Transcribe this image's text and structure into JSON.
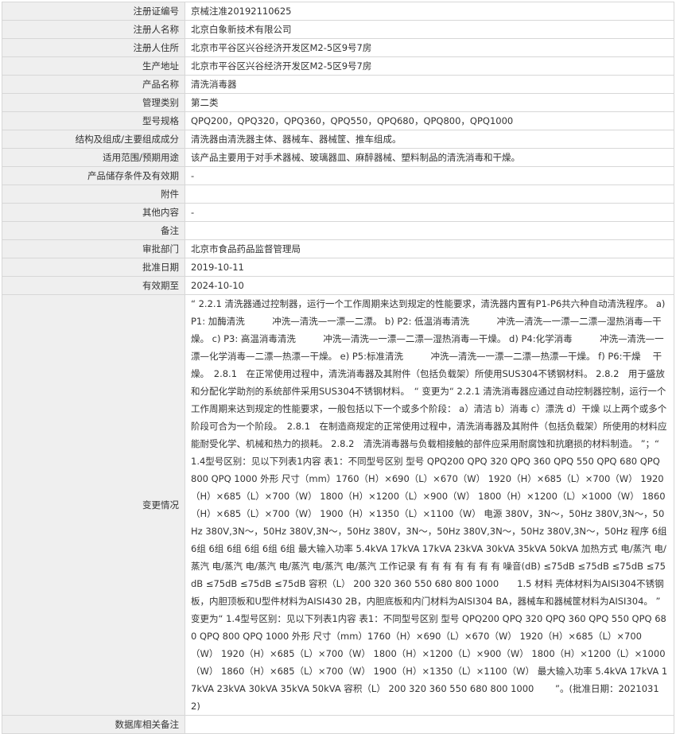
{
  "rows": [
    {
      "label": "注册证编号",
      "value": "京械注准20192110625"
    },
    {
      "label": "注册人名称",
      "value": "北京白象新技术有限公司"
    },
    {
      "label": "注册人住所",
      "value": "北京市平谷区兴谷经济开发区M2-5区9号7房"
    },
    {
      "label": "生产地址",
      "value": "北京市平谷区兴谷经济开发区M2-5区9号7房"
    },
    {
      "label": "产品名称",
      "value": "清洗消毒器"
    },
    {
      "label": "管理类别",
      "value": "第二类"
    },
    {
      "label": "型号规格",
      "value": "QPQ200，QPQ320，QPQ360，QPQ550，QPQ680，QPQ800，QPQ1000"
    },
    {
      "label": "结构及组成/主要组成成分",
      "value": "清洗器由清洗器主体、器械车、器械筐、推车组成。"
    },
    {
      "label": "适用范围/预期用途",
      "value": "该产品主要用于对手术器械、玻璃器皿、麻醉器械、塑料制品的清洗消毒和干燥。"
    },
    {
      "label": "产品储存条件及有效期",
      "value": "-"
    },
    {
      "label": "附件",
      "value": ""
    },
    {
      "label": "其他内容",
      "value": "-"
    },
    {
      "label": "备注",
      "value": ""
    },
    {
      "label": "审批部门",
      "value": "北京市食品药品监督管理局"
    },
    {
      "label": "批准日期",
      "value": "2019-10-11"
    },
    {
      "label": "有效期至",
      "value": "2024-10-10"
    },
    {
      "label": "变更情况",
      "value": "“ 2.2.1 清洗器通过控制器，运行一个工作周期来达到规定的性能要求，清洗器内置有P1-P6共六种自动清洗程序。 a) P1: 加酶清洗　　　冲洗—清洗—一漂—二漂。 b) P2: 低温消毒清洗　　　冲洗—清洗—一漂—二漂—湿热消毒—干燥。 c) P3: 高温消毒清洗　　　冲洗—清洗—一漂—二漂—湿热消毒—干燥。 d) P4:化学消毒　　　冲洗—清洗—一漂—化学消毒—二漂—热漂—干燥。 e) P5:标准清洗　　　冲洗—清洗—一漂—二漂—热漂—干燥。 f) P6:干燥　 干燥。　2.8.1　在正常使用过程中，清洗消毒器及其附件（包括负载架）所使用SUS304不锈钢材料。 2.8.2　用于盛放和分配化学助剂的系统部件采用SUS304不锈钢材料。　“ 变更为“ 2.2.1 清洗消毒器应通过自动控制器控制，运行一个工作周期来达到规定的性能要求，一般包括以下一个或多个阶段： a）清洁 b）消毒 c）漂洗 d）干燥 以上两个或多个阶段可合为一个阶段。　2.8.1　在制造商规定的正常使用过程中，清洗消毒器及其附件（包括负载架）所使用的材料应能耐受化学、机械和热力的损耗。 2.8.2　清洗消毒器与负载相接触的部件应采用耐腐蚀和抗磨损的材料制造。 ”；“ 1.4型号区别：见以下列表1内容 表1：不同型号区别 型号 QPQ200 QPQ 320 QPQ 360 QPQ 550 QPQ 680 QPQ 800 QPQ 1000 外形 尺寸（mm）1760（H）×690（L）×670（W） 1920（H）×685（L）×700（W） 1920（H）×685（L）×700（W） 1800（H）×1200（L）×900（W） 1800（H）×1200（L）×1000（W） 1860（H）×685（L）×700（W） 1900（H）×1350（L）×1100（W） 电源 380V，3N～，50Hz 380V,3N～，50Hz 380V,3N～，50Hz 380V,3N～，50Hz 380V，3N～，50Hz 380V,3N～，50Hz 380V,3N～，50Hz 程序 6组 6组 6组 6组 6组 6组 6组 最大输入功率 5.4kVA 17kVA 17kVA 23kVA 30kVA 35kVA 50kVA 加热方式 电/蒸汽 电/蒸汽 电/蒸汽 电/蒸汽 电/蒸汽 电/蒸汽 电/蒸汽 工作记录 有 有 有 有 有 有 有 噪音(dB) ≤75dB ≤75dB ≤75dB ≤75dB ≤75dB ≤75dB ≤75dB 容积（L） 200 320 360 550 680 800 1000　　1.5 材料 壳体材料为AISI304不锈钢板，内胆顶板和U型件材料为AISI430 2B，内胆底板和内门材料为AISI304 BA，器械车和器械筐材料为AISI304。 ” 变更为“ 1.4型号区别：见以下列表1内容 表1：不同型号区别 型号 QPQ200 QPQ 320 QPQ 360 QPQ 550 QPQ 680 QPQ 800 QPQ 1000 外形 尺寸（mm）1760（H）×690（L）×670（W） 1920（H）×685（L）×700（W） 1920（H）×685（L）×700（W） 1800（H）×1200（L）×900（W） 1800（H）×1200（L）×1000（W） 1860（H）×685（L）×700（W） 1900（H）×1350（L）×1100（W） 最大输入功率 5.4kVA 17kVA 17kVA 23kVA 30kVA 35kVA 50kVA 容积（L） 200 320 360 550 680 800 1000　　 ”。(批准日期：20210312)"
    },
    {
      "label": "数据库相关备注",
      "value": ""
    }
  ]
}
